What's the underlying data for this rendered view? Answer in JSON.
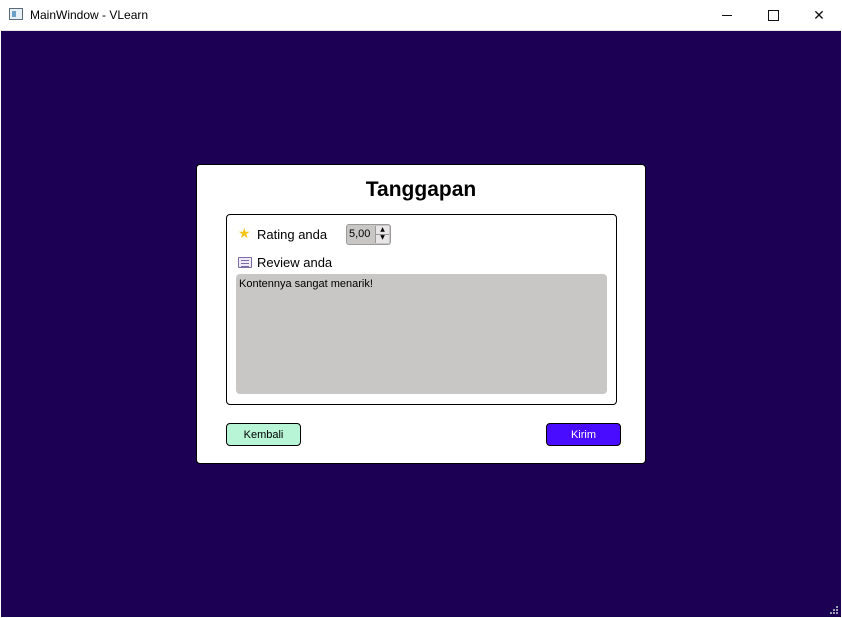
{
  "window": {
    "title": "MainWindow - VLearn"
  },
  "dialog": {
    "title": "Tanggapan",
    "rating": {
      "label": "Rating anda",
      "value": "5,00",
      "icon": "star-icon"
    },
    "review": {
      "label": "Review anda",
      "text": "Kontennya sangat menarik!",
      "icon": "document-icon"
    },
    "buttons": {
      "back": "Kembali",
      "send": "Kirim"
    }
  },
  "colors": {
    "background": "#1b0053",
    "back_button": "#b8f5d6",
    "send_button": "#4a0cff",
    "input_fill": "#c9c6c6",
    "star": "#f2c417"
  }
}
